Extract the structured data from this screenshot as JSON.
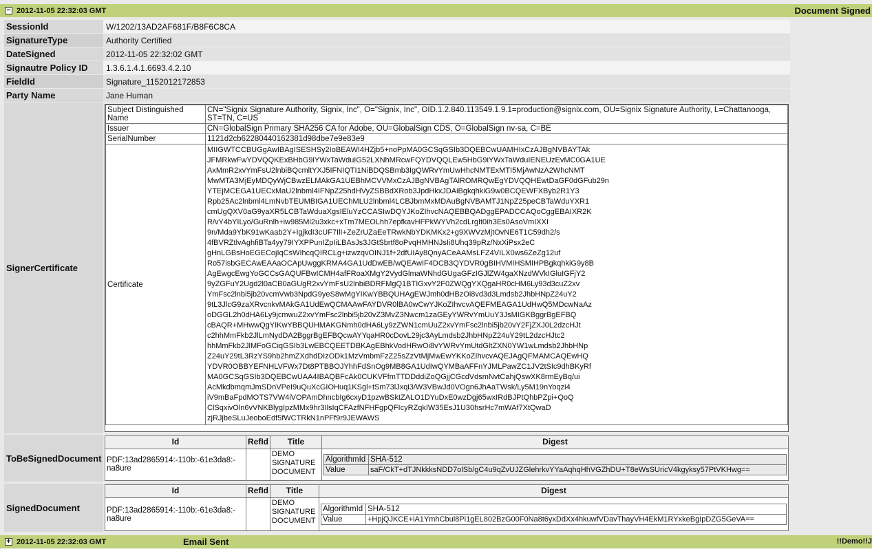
{
  "top_bar": {
    "toggle": "−",
    "timestamp": "2012-11-05 22:32:03 GMT",
    "event": "Document Signed"
  },
  "fields": [
    {
      "key": "SessionId",
      "value": "W/1202/13AD2AF681F/B8F6C8CA"
    },
    {
      "key": "SignatureType",
      "value": "Authority Certified"
    },
    {
      "key": "DateSigned",
      "value": "2012-11-05 22:32:02 GMT"
    },
    {
      "key": "Signautre Policy ID",
      "value": "1.3.6.1.4.1.6693.4.2.10"
    },
    {
      "key": "FieldId",
      "value": "Signature_1152012172853"
    },
    {
      "key": "Party Name",
      "value": "Jane Human"
    }
  ],
  "signer_certificate": {
    "label": "SignerCertificate",
    "subject_label": "Subject Distinguished Name",
    "subject_value": "CN=\"Signix Signature Authority, Signix, Inc\", O=\"Signix, Inc\", OID.1.2.840.113549.1.9.1=production@signix.com, OU=Signix Signature Authority, L=Chattanooga, ST=TN, C=US",
    "issuer_label": "Issuer",
    "issuer_value": "CN=GlobalSign Primary SHA256 CA for Adobe, OU=GlobalSign CDS, O=GlobalSign nv-sa, C=BE",
    "serial_label": "SerialNumber",
    "serial_value": "1121d2cb62280440162381d98dbe7e9e83e9",
    "cert_label": "Certificate",
    "cert_lines": [
      "MIIGWTCCBUGgAwIBAgISESHSy2IoBEAWI4HZjb5+noPpMA0GCSqGSIb3DQEBCwUAMHIxCzAJBgNVBAYTAk",
      "JFMRkwFwYDVQQKExBHbG9iYWxTaWduIG52LXNhMRcwFQYDVQQLEw5HbG9iYWxTaWduIENEUzEvMC0GA1UE",
      "AxMmR2xvYmFsU2lnbiBQcmltYXJ5IFNIQTI1NiBDQSBmb3IgQWRvYmUwHhcNMTExMTI5MjAwNzA2WhcNMT",
      "MwMTA3MjEyMDQyWjCBwzELMAkGA1UEBhMCVVMxCzAJBgNVBAgTAlROMRQwEgYDVQQHEwtDaGF0dGFub29n",
      "YTEjMCEGA1UECxMaU2lnbml4IFNpZ25hdHVyZSBBdXRob3JpdHkxJDAiBgkqhkiG9w0BCQEWFXByb2R1Y3",
      "Rpb25Ac2lnbml4LmNvbTEUMBIGA1UEChMLU2lnbml4LCBJbmMxMDAuBgNVBAMTJ1NpZ25peCBTaWduYXR1",
      "cmUgQXV0aG9yaXR5LCBTaWduaXgsIEluYzCCASIwDQYJKoZIhvcNAQEBBQADggEPADCCAQoCggEBAIXR2K",
      "R/vY4bYILyo/GuRnlh+iw985Mi2u3xkc+xTm7MEOLhh7epfkavHFPkWYVh2cdLrgIt0ih3Es0AsoVmIXXI",
      "9n/Mda9YbK91wKaab2Y+IgjkdI3cUF7IlI+ZeZrUZaEeTRwkNbYDKMKx2+g9XWVzMjtOvNE6T1C59dh2/s",
      "4fBVRZtlvAghfiBTa4yy79IYXPPunIZpIiLBAsJs3JGtSbrtf8oPvqHMHNJsIi8Uhq39pRz/NxXiPsx2eC",
      "gHnLGBsHoEGECojIqCsWIhcqQIRCLg+izwzqvOINJ1f+2dfUIAy8QnyACeAAMsLFZ4VILX0ws6ZeZg12uf",
      "Ro57isbGECAwEAAaOCApUwggKRMA4GA1UdDwEB/wQEAwIF4DCB3QYDVR0gBIHVMIHSMIHPBgkqhkiG9y8B",
      "AgEwgcEwgYoGCCsGAQUFBwICMH4afFRoaXMgY2VydGlmaWNhdGUgaGFzIGJlZW4gaXNzdWVkIGluIGFjY2",
      "9yZGFuY2Ugd2l0aCB0aGUgR2xvYmFsU2lnbiBDRFMgQ1BTIGxvY2F0ZWQgYXQgaHR0cHM6Ly93d3cuZ2xv",
      "YmFsc2lnbi5jb20vcmVwb3NpdG9yeS8wMgYIKwYBBQUHAgEWJmh0dHBzOi8vd3d3Lmdsb2JhbHNpZ24uY2",
      "9tL3JlcG9zaXRvcnkvMAkGA1UdEwQCMAAwFAYDVR0lBA0wCwYJKoZIhvcvAQEFMEAGA1UdHwQ5MDcwNaAz",
      "oDGGL2h0dHA6Ly9jcmwuZ2xvYmFsc2lnbi5jb20vZ3MvZ3Nwcm1zaGEyYWRvYmUuY3JsMIGKBggrBgEFBQ",
      "cBAQR+MHwwQgYIKwYBBQUHMAKGNmh0dHA6Ly9zZWN1cmUuZ2xvYmFsc2lnbi5jb20vY2FjZXJ0L2dzcHJt",
      "c2hhMmFkb2JlLmNydDA2BggrBgEFBQcwAYYqaHR0cDovL29jc3AyLmdsb2JhbHNpZ24uY29tL2dzcHJtc2",
      "hhMmFkb2JlMFoGCiqGSIb3LwEBCQEETDBKAgEBhkVodHRwOi8vYWRvYmUtdGltZXN0YW1wLmdsb2JhbHNp",
      "Z24uY29tL3RzYS9hb2hmZXdhdDIzODk1MzVmbmFzZ25sZzVtMjMwEwYKKoZIhvcvAQEJAgQFMAMCAQEwHQ",
      "YDVR0OBBYEFNHLVFWx7Dt8PTBBOJYhhFdSnOg9MB8GA1UdIwQYMBaAFFnYJMLPawZC1JV2tSIc9dhBKyRf",
      "MA0GCSqGSIb3DQEBCwUAA4IBAQBFcAk0CUKVFfmTTDDddiZoQGjjCGcdVdsmNvtCahjQswXK8rmEyBq/ui",
      "AcMkdbmqmJmSDnVPeI9uQuXcGIOHuq1KSgl+tSm73lJxqi3/W3VBwJd0VOgn6JhAaTWsk/Ly5M19nYoqzi4",
      "iV9mBaFpdMOTS7VW4iVOPAmDhncbIg6cxyD1pzwBSktZALO1DYuDxE0wzDgj65wxIRdBJPtQhbPZpi+QoQ",
      "ClSqxivOln6vVNKBlygIpzMMx9hr3IlsIqCFAzfNFHFgpQFIcyRZqkIW35EsJ1U30hsrHc7mWAf7XtQwaD",
      "zjRJjbeSLuJeoboEdf5fWCTRkN1nPFf9r9JEWAWS"
    ]
  },
  "to_be_signed": {
    "label": "ToBeSignedDocument",
    "headers": [
      "Id",
      "RefId",
      "Title",
      "Digest"
    ],
    "id": "PDF:13ad2865914:-110b:-61e3da8:-na8ure",
    "refid": "",
    "title": "DEMO SIGNATURE DOCUMENT",
    "algo_label": "AlgorithmId",
    "algo_value": "SHA-512",
    "value_label": "Value",
    "value": "saF/CkT+dTJNkkksNDD7olSb/gC4u9qZvUJZGlehrkvYYaAqhqHhVGZhDU+T8eWsSUricV4kgyksy57PtVKHwg=="
  },
  "signed": {
    "label": "SignedDocument",
    "headers": [
      "Id",
      "RefId",
      "Title",
      "Digest"
    ],
    "id": "PDF:13ad2865914:-110b:-61e3da8:-na8ure",
    "refid": "",
    "title": "DEMO SIGNATURE DOCUMENT",
    "algo_label": "AlgorithmId",
    "algo_value": "SHA-512",
    "value_label": "Value",
    "value": "+HpjQJKCE+iA1YmhCbul8Pi1gEL802BzG00F0Na8t6yxDdXx4hkuwfVDavThayVH4EkM1RYxkeBgIpDZG5GeVA=="
  },
  "bottom_bar": {
    "toggle": "+",
    "timestamp": "2012-11-05 22:32:03 GMT",
    "event": "Email Sent",
    "right": "!!Demo!!J"
  }
}
